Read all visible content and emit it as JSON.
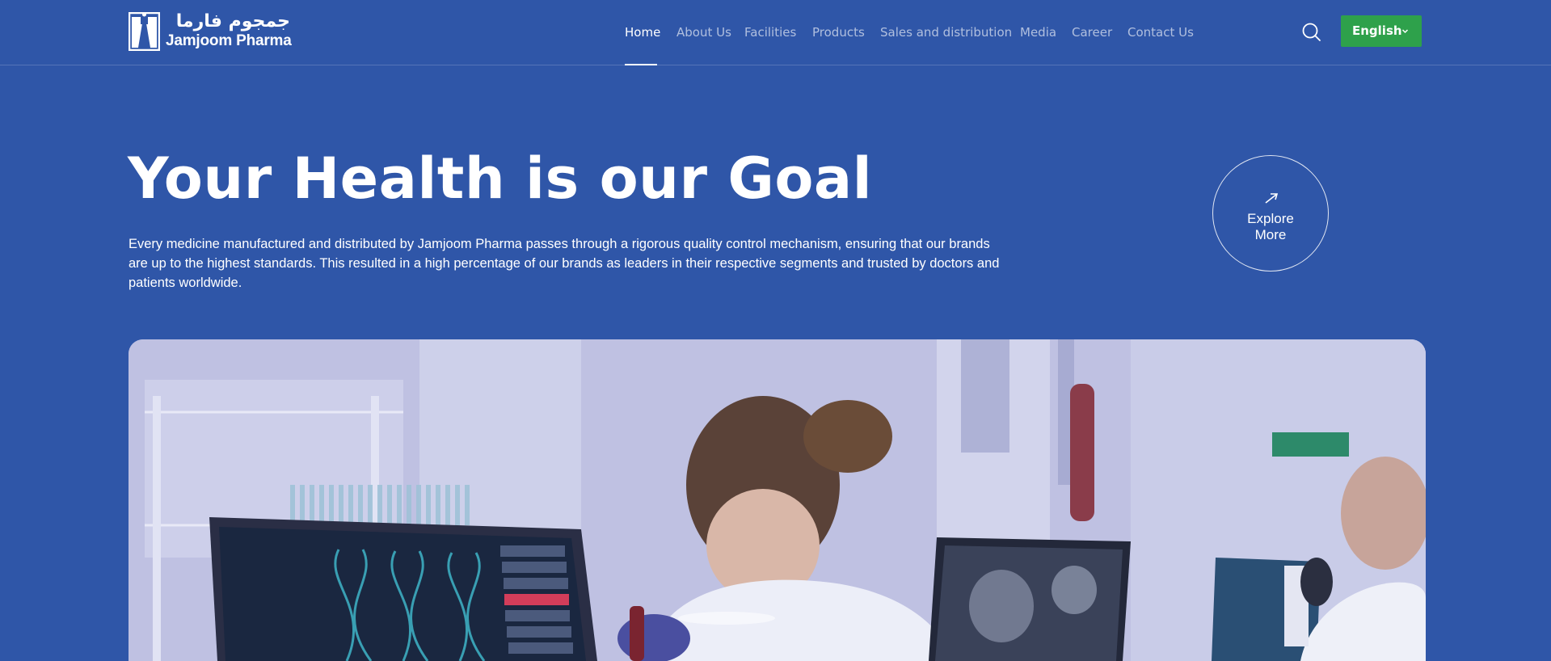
{
  "header": {
    "logo_arabic": "جمجوم فارما",
    "logo_english": "Jamjoom Pharma",
    "nav": [
      "Home",
      "About Us",
      "Facilities",
      "Products",
      "Sales and distribution",
      "Media",
      "Career",
      "Contact Us"
    ],
    "active_nav": "Home",
    "search_icon": "search-icon",
    "language": "English"
  },
  "hero": {
    "title": "Your Health is our Goal",
    "description": "Every medicine manufactured and distributed by Jamjoom Pharma passes through a rigorous quality control mechanism, ensuring that our brands are up to the highest standards. This resulted in a high percentage of our brands as leaders in their respective segments and trusted by doctors and patients worldwide.",
    "explore_line1": "Explore",
    "explore_line2": "More"
  },
  "colors": {
    "background": "#2f56a8",
    "language_button": "#2ea14b",
    "text": "#ffffff"
  }
}
